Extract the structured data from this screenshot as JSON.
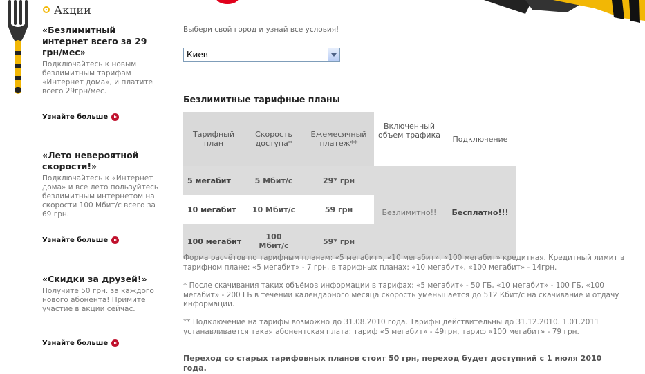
{
  "section": {
    "title": "Акции"
  },
  "promos": [
    {
      "title": "«Безлимитный интернет всего за 29 грн/мес»",
      "text": "Подключайтесь к новым безлимитным тарифам «Интернет дома», и платите всего 29грн/мес.",
      "link": "Узнайте больше"
    },
    {
      "title": "«Лето невероятной скорости!»",
      "text": "Подключайтесь к «Интернет дома» и все лето пользуйтесь безлимитным интернетом на скорости 100 Мбит/с всего за 69 грн.",
      "link": "Узнайте больше"
    },
    {
      "title": "«Скидки за друзей!»",
      "text": "Получите 50 грн. за каждого нового абонента! Примите участие в акции сейчас.",
      "link": "Узнайте больше"
    }
  ],
  "main": {
    "intro": "Выбери свой город и узнай все условия!",
    "city_select": {
      "value": "Киев"
    },
    "table_title": "Безлимитные тарифные планы",
    "table": {
      "headers": [
        "Тарифный план",
        "Скорость доступа*",
        "Ежемесячный платеж**",
        "Включенный объем трафика",
        "Подключение"
      ],
      "rows": [
        {
          "plan": "5 мегабит",
          "speed": "5 Мбит/с",
          "price": "29* грн"
        },
        {
          "plan": "10 мегабит",
          "speed": "10 Мбит/с",
          "price": "59 грн"
        },
        {
          "plan": "100 мегабит",
          "speed": "100 Мбит/с",
          "price": "59* грн"
        }
      ],
      "traffic": "Безлимитно!!",
      "connection": "Бесплатно!!!"
    },
    "notes": {
      "credit": "Форма расчётов по тарифным планам: «5 мегабит», «10 мегабит», «100 мегабит» кредитная. Кредитный лимит в тарифном плане: «5 мегабит» - 7 грн, в тарифных планах: «10 мегабит», «100 мегабит» - 14грн.",
      "footnote1": "* После скачивания таких объёмов информации в тарифах: «5 мегабит» - 50 ГБ, «10 мегабит» - 100 ГБ, «100 мегабит» - 200 ГБ в течении календарного месяца скорость уменьшается до 512 Кбит/с на скачивание и отдачу информации.",
      "footnote2": "** Подключение на тарифы возможно до 31.08.2010 года. Тарифы действительны до 31.12.2010. 1.01.2011 устанавливается такая абонентская плата: тариф «5 мегабит» - 49грн, тариф «100 мегабит» - 79 грн.",
      "transition": "Переход со старых тарифовных планов стоит 50 грн, переход будет доступний с 1 июля 2010 года."
    }
  },
  "colors": {
    "accent_yellow": "#f2b705",
    "link_red": "#c0112d",
    "table_grey": "#dcdcdc"
  }
}
